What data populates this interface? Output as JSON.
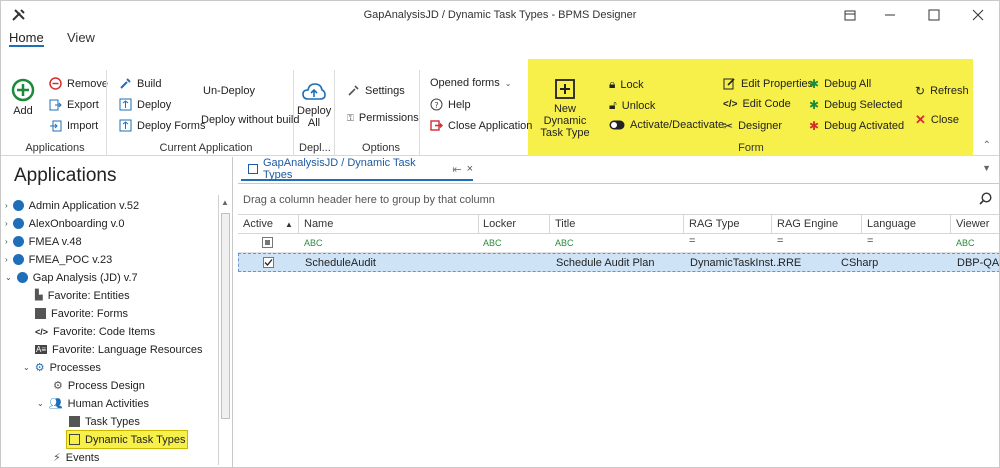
{
  "window": {
    "title": "GapAnalysisJD / Dynamic Task Types - BPMS Designer",
    "icons": [
      "tools-icon",
      "restore-icon",
      "minimize-icon",
      "maximize-icon",
      "close-icon"
    ]
  },
  "ribbon_tabs": [
    "Home",
    "View"
  ],
  "ribbon": {
    "applications": {
      "add": "Add",
      "remove": "Remove",
      "export": "Export",
      "import": "Import",
      "label": "Applications"
    },
    "current_application": {
      "build": "Build",
      "deploy": "Deploy",
      "deploy_forms": "Deploy Forms",
      "undeploy": "Un-Deploy",
      "deploy_without_build": "Deploy without build",
      "label": "Current Application"
    },
    "deployment": {
      "deploy_all_line1": "Deploy",
      "deploy_all_line2": "All",
      "label": "Depl..."
    },
    "options": {
      "settings": "Settings",
      "permissions": "Permissions",
      "label": "Options"
    },
    "opened_forms": {
      "opened_forms": "Opened forms",
      "help": "Help",
      "close_application": "Close Application"
    },
    "form": {
      "new_line1": "New Dynamic",
      "new_line2": "Task Type",
      "lock": "Lock",
      "unlock": "Unlock",
      "activate": "Activate/Deactivate",
      "edit_properties": "Edit Properties",
      "edit_code": "Edit Code",
      "designer": "Designer",
      "debug_all": "Debug All",
      "debug_selected": "Debug Selected",
      "debug_activated": "Debug Activated",
      "refresh": "Refresh",
      "close": "Close",
      "label": "Form"
    }
  },
  "left_panel": {
    "title": "Applications",
    "tree": [
      {
        "label": "Admin Application v.52"
      },
      {
        "label": "AlexOnboarding v.0"
      },
      {
        "label": "FMEA v.48"
      },
      {
        "label": "FMEA_POC v.23"
      },
      {
        "label": "Gap Analysis (JD) v.7"
      },
      {
        "label": "Favorite: Entities"
      },
      {
        "label": "Favorite: Forms"
      },
      {
        "label": "Favorite: Code Items"
      },
      {
        "label": "Favorite: Language Resources"
      },
      {
        "label": "Processes"
      },
      {
        "label": "Process Design"
      },
      {
        "label": "Human Activities"
      },
      {
        "label": "Task Types"
      },
      {
        "label": "Dynamic Task Types"
      },
      {
        "label": "Events"
      }
    ]
  },
  "document": {
    "tab_title": "GapAnalysisJD / Dynamic Task Types",
    "pin": "⇤",
    "close": "×",
    "group_hint": "Drag a column header here to group by that column",
    "columns": [
      "Active",
      "Name",
      "Locker",
      "Title",
      "RAG Type",
      "RAG Engine",
      "Language",
      "Viewer"
    ],
    "filter_row": {
      "text_filter": "ABC",
      "equals_filter": "="
    },
    "rows": [
      {
        "active": true,
        "name": "ScheduleAudit",
        "locker": "",
        "title": "Schedule Audit Plan",
        "rag_type": "DynamicTaskInst...",
        "rag_engine": "RRE",
        "language": "CSharp",
        "viewer": "DBP-QA"
      }
    ]
  },
  "colors": {
    "accent": "#1e6fb8",
    "highlight": "#f7f04a",
    "selection": "#cfe3f7",
    "remove_red": "#d32f2f",
    "add_green": "#1b8a3a"
  }
}
